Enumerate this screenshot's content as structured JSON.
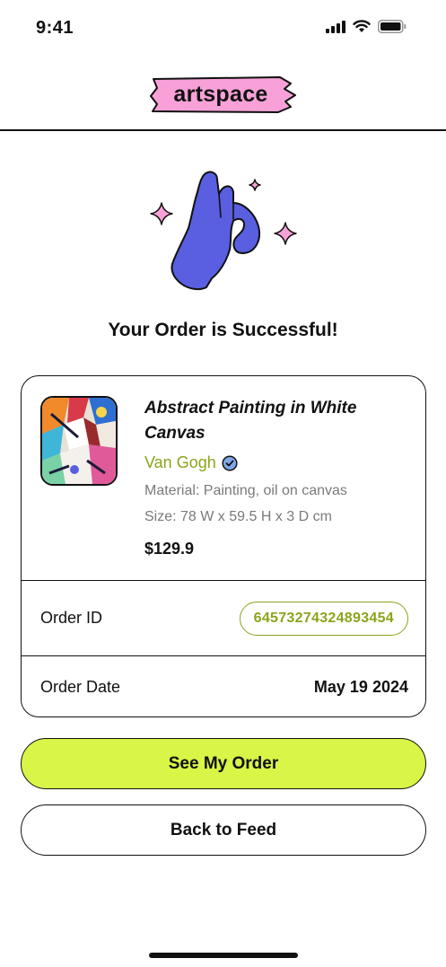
{
  "status_bar": {
    "time": "9:41"
  },
  "header": {
    "logo_text": "artspace"
  },
  "success": {
    "title": "Your Order is Successful!"
  },
  "product": {
    "title": "Abstract Painting in White Canvas",
    "artist": "Van Gogh",
    "material": "Material: Painting, oil on canvas",
    "size": "Size: 78 W x 59.5 H x 3 D cm",
    "price": "$129.9"
  },
  "order": {
    "id_label": "Order ID",
    "id_value": "64573274324893454",
    "date_label": "Order Date",
    "date_value": "May 19 2024"
  },
  "actions": {
    "primary_label": "See My Order",
    "secondary_label": "Back to Feed"
  },
  "colors": {
    "accent_lime": "#d8f548",
    "artist_green": "#8aa51a",
    "logo_pink": "#f7a1d8",
    "hand_purple": "#5a5ee0",
    "verified_blue": "#7fa8e8"
  }
}
